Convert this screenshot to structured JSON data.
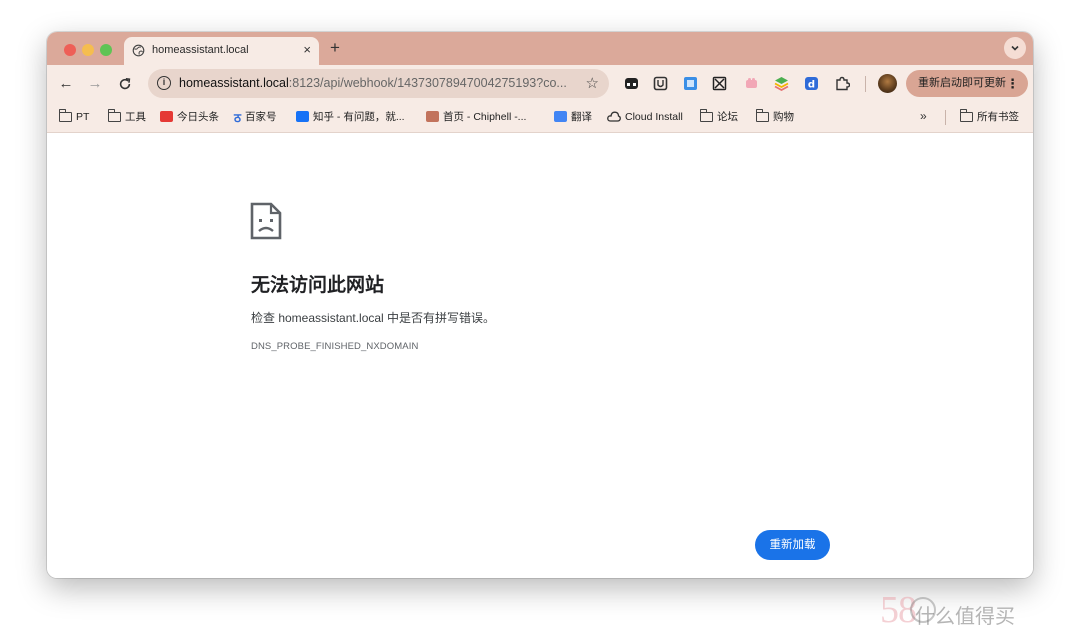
{
  "tab": {
    "title": "homeassistant.local",
    "close_label": "×",
    "new_tab_label": "+",
    "dropdown_label": "⌄"
  },
  "toolbar": {
    "back_label": "←",
    "forward_label": "→",
    "reload_label": "C",
    "url_host": "homeassistant.local",
    "url_rest": ":8123/api/webhook/14373078947004275193?co...",
    "star_label": "☆",
    "update_button_label": "重新启动即可更新",
    "update_menu_label": "⋮"
  },
  "bookmarks": {
    "items": [
      {
        "label": "PT",
        "icon": "folder-icon"
      },
      {
        "label": "工具",
        "icon": "folder-icon"
      },
      {
        "label": "今日头条",
        "icon": "toutiao-icon"
      },
      {
        "label": "百家号",
        "icon": "baijiahao-icon"
      },
      {
        "label": "知乎 - 有问题，就...",
        "icon": "zhihu-icon"
      },
      {
        "label": "首页 - Chiphell -...",
        "icon": "chiphell-icon"
      },
      {
        "label": "翻译",
        "icon": "translate-icon"
      },
      {
        "label": "Cloud Install",
        "icon": "cloud-icon"
      },
      {
        "label": "论坛",
        "icon": "folder-icon"
      },
      {
        "label": "购物",
        "icon": "folder-icon"
      }
    ],
    "more_label": "»",
    "all_bookmarks_label": "所有书签"
  },
  "error_page": {
    "title": "无法访问此网站",
    "description": "检查 homeassistant.local 中是否有拼写错误。",
    "error_code": "DNS_PROBE_FINISHED_NXDOMAIN",
    "reload_button_label": "重新加载"
  },
  "watermark": {
    "number": "58",
    "text": "什么值得买"
  },
  "colors": {
    "tabstrip": "#dba99a",
    "toolbar": "#f7ebe5",
    "reload_button": "#1a73e8"
  }
}
